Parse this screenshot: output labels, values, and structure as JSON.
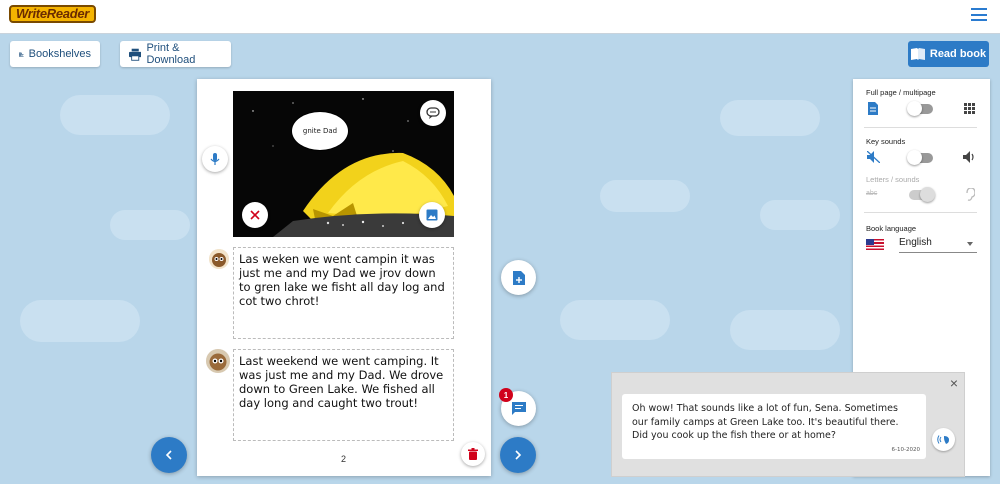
{
  "app": {
    "logo_text": "WriteReader"
  },
  "toolbar": {
    "bookshelves_label": "Bookshelves",
    "print_label": "Print & Download",
    "read_label": "Read book"
  },
  "page": {
    "speech_bubble": "gnite Dad",
    "child_text": "Las weken we went campin it was just me and my Dad we jrov down to gren lake we fisht all day log and cot two chrot!",
    "adult_text": "Last weekend we went camping. It was just me and my Dad. We drove down to Green Lake. We fished all day long and caught two trout!",
    "page_number": "2"
  },
  "settings": {
    "full_page_label": "Full page / multipage",
    "key_sounds_label": "Key sounds",
    "letters_sounds_label": "Letters / sounds",
    "book_language_label": "Book language",
    "language_value": "English"
  },
  "chat": {
    "message": "Oh wow! That sounds like a lot of fun, Sena. Sometimes our family camps at Green Lake too. It's beautiful there. Did you cook up the fish there or at home?",
    "date": "6-10-2020",
    "badge_count": "1"
  },
  "colors": {
    "accent": "#2d7bc6",
    "background": "#b9d6ea",
    "badge": "#d0021b"
  },
  "icons": [
    "menu-icon",
    "bookshelves-icon",
    "printer-icon",
    "book-open-icon",
    "microphone-icon",
    "speech-bubble-icon",
    "close-x-icon",
    "image-icon",
    "add-page-icon",
    "comment-icon",
    "trash-icon",
    "chevron-left-icon",
    "chevron-right-icon",
    "document-icon",
    "grid-icon",
    "volume-off-icon",
    "volume-on-icon",
    "ear-icon",
    "speak-icon"
  ]
}
